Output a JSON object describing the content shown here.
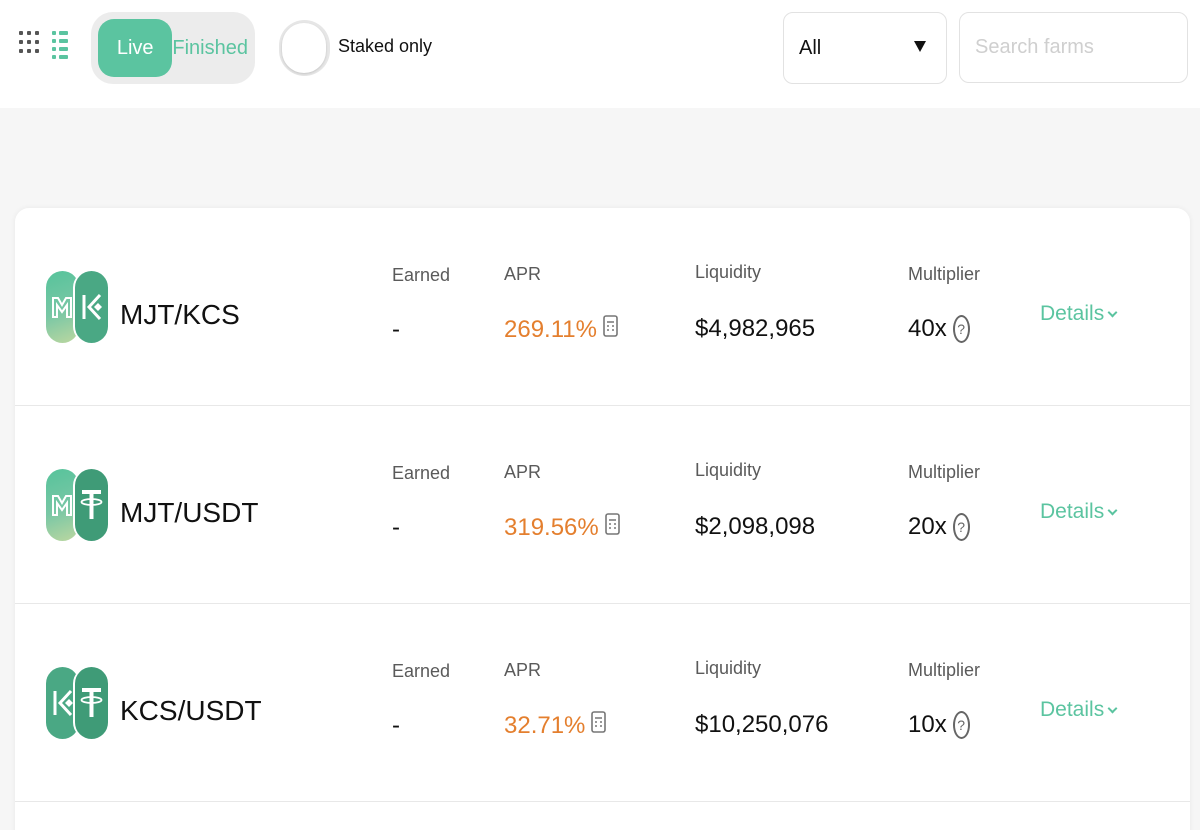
{
  "toolbar": {
    "live_label": "Live",
    "finished_label": "Finished",
    "staked_only_label": "Staked only",
    "filter_value": "All",
    "search_placeholder": "Search farms"
  },
  "colors": {
    "accent": "#5bc4a0",
    "apr": "#e47f2e"
  },
  "farms": [
    {
      "pair": "MJT/KCS",
      "tokens": [
        "mjt-icon",
        "kcs-icon"
      ],
      "earned_label": "Earned",
      "earned": "-",
      "apr_label": "APR",
      "apr": "269.11%",
      "liquidity_label": "Liquidity",
      "liquidity": "$4,982,965",
      "multiplier_label": "Multiplier",
      "multiplier": "40x",
      "details_label": "Details"
    },
    {
      "pair": "MJT/USDT",
      "tokens": [
        "mjt-icon",
        "usdt-icon"
      ],
      "earned_label": "Earned",
      "earned": "-",
      "apr_label": "APR",
      "apr": "319.56%",
      "liquidity_label": "Liquidity",
      "liquidity": "$2,098,098",
      "multiplier_label": "Multiplier",
      "multiplier": "20x",
      "details_label": "Details"
    },
    {
      "pair": "KCS/USDT",
      "tokens": [
        "kcs-icon",
        "usdt-icon"
      ],
      "earned_label": "Earned",
      "earned": "-",
      "apr_label": "APR",
      "apr": "32.71%",
      "liquidity_label": "Liquidity",
      "liquidity": "$10,250,076",
      "multiplier_label": "Multiplier",
      "multiplier": "10x",
      "details_label": "Details"
    }
  ]
}
